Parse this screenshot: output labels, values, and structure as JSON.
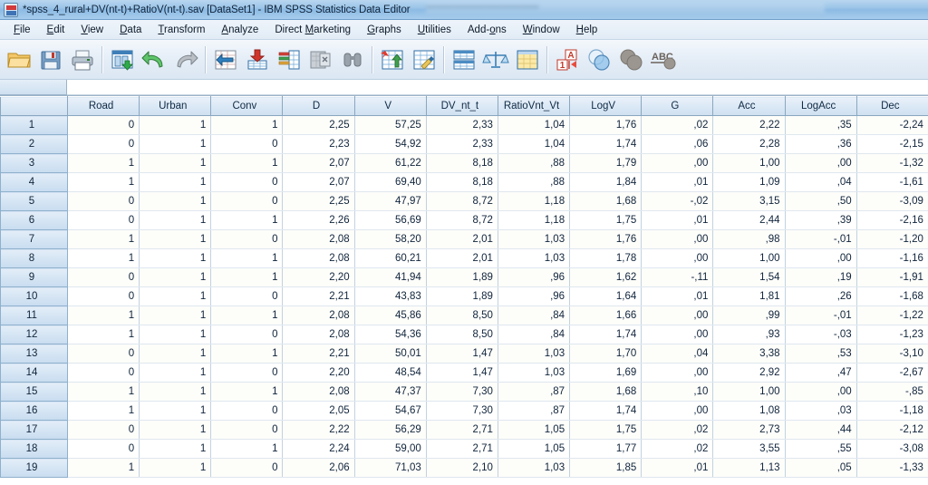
{
  "window": {
    "title": "*spss_4_rural+DV(nt-t)+RatioV(nt-t).sav [DataSet1] - IBM SPSS Statistics Data Editor",
    "icon": "spss-app-icon",
    "overlay_blurred_text": "••••••••••••••••••••••••••••••••"
  },
  "menubar": {
    "items": [
      {
        "label": "File",
        "accel": "F"
      },
      {
        "label": "Edit",
        "accel": "E"
      },
      {
        "label": "View",
        "accel": "V"
      },
      {
        "label": "Data",
        "accel": "D"
      },
      {
        "label": "Transform",
        "accel": "T"
      },
      {
        "label": "Analyze",
        "accel": "A"
      },
      {
        "label": "Direct Marketing",
        "accel": "M"
      },
      {
        "label": "Graphs",
        "accel": "G"
      },
      {
        "label": "Utilities",
        "accel": "U"
      },
      {
        "label": "Add-ons",
        "accel": "o"
      },
      {
        "label": "Window",
        "accel": "W"
      },
      {
        "label": "Help",
        "accel": "H"
      }
    ]
  },
  "toolbar": {
    "buttons": [
      {
        "name": "open-file-icon",
        "tooltip": "Open data document"
      },
      {
        "name": "save-icon",
        "tooltip": "Save this document"
      },
      {
        "name": "print-icon",
        "tooltip": "Print"
      },
      {
        "name": "recall-dialogs-icon",
        "tooltip": "Recall recently used dialogs"
      },
      {
        "name": "undo-icon",
        "tooltip": "Undo a user action"
      },
      {
        "name": "redo-icon",
        "tooltip": "Redo a user action"
      },
      {
        "name": "goto-case-icon",
        "tooltip": "Go to case"
      },
      {
        "name": "goto-variable-icon",
        "tooltip": "Go to variable"
      },
      {
        "name": "variables-icon",
        "tooltip": "Variables"
      },
      {
        "name": "find-icon",
        "tooltip": "Find"
      },
      {
        "name": "insert-case-icon",
        "tooltip": "Insert cases"
      },
      {
        "name": "insert-variable-icon",
        "tooltip": "Insert variable"
      },
      {
        "name": "split-file-icon",
        "tooltip": "Split file"
      },
      {
        "name": "weight-cases-icon",
        "tooltip": "Weight cases"
      },
      {
        "name": "select-cases-icon",
        "tooltip": "Select cases"
      },
      {
        "name": "value-labels-icon",
        "tooltip": "Value labels"
      },
      {
        "name": "use-variable-sets-icon",
        "tooltip": "Use variable sets"
      },
      {
        "name": "show-all-variables-icon",
        "tooltip": "Show all variables"
      },
      {
        "name": "spell-check-icon",
        "tooltip": "Spell check"
      }
    ]
  },
  "cell_reference": {
    "name": "",
    "value": ""
  },
  "grid": {
    "corner_label": "",
    "columns": [
      "Road",
      "Urban",
      "Conv",
      "D",
      "V",
      "DV_nt_t",
      "RatioVnt_Vt",
      "LogV",
      "G",
      "Acc",
      "LogAcc",
      "Dec"
    ],
    "rows": [
      {
        "num": "1",
        "cells": [
          "0",
          "1",
          "1",
          "2,25",
          "57,25",
          "2,33",
          "1,04",
          "1,76",
          ",02",
          "2,22",
          ",35",
          "-2,24"
        ]
      },
      {
        "num": "2",
        "cells": [
          "0",
          "1",
          "0",
          "2,23",
          "54,92",
          "2,33",
          "1,04",
          "1,74",
          ",06",
          "2,28",
          ",36",
          "-2,15"
        ]
      },
      {
        "num": "3",
        "cells": [
          "1",
          "1",
          "1",
          "2,07",
          "61,22",
          "8,18",
          ",88",
          "1,79",
          ",00",
          "1,00",
          ",00",
          "-1,32"
        ]
      },
      {
        "num": "4",
        "cells": [
          "1",
          "1",
          "0",
          "2,07",
          "69,40",
          "8,18",
          ",88",
          "1,84",
          ",01",
          "1,09",
          ",04",
          "-1,61"
        ]
      },
      {
        "num": "5",
        "cells": [
          "0",
          "1",
          "0",
          "2,25",
          "47,97",
          "8,72",
          "1,18",
          "1,68",
          "-,02",
          "3,15",
          ",50",
          "-3,09"
        ]
      },
      {
        "num": "6",
        "cells": [
          "0",
          "1",
          "1",
          "2,26",
          "56,69",
          "8,72",
          "1,18",
          "1,75",
          ",01",
          "2,44",
          ",39",
          "-2,16"
        ]
      },
      {
        "num": "7",
        "cells": [
          "1",
          "1",
          "0",
          "2,08",
          "58,20",
          "2,01",
          "1,03",
          "1,76",
          ",00",
          ",98",
          "-,01",
          "-1,20"
        ]
      },
      {
        "num": "8",
        "cells": [
          "1",
          "1",
          "1",
          "2,08",
          "60,21",
          "2,01",
          "1,03",
          "1,78",
          ",00",
          "1,00",
          ",00",
          "-1,16"
        ]
      },
      {
        "num": "9",
        "cells": [
          "0",
          "1",
          "1",
          "2,20",
          "41,94",
          "1,89",
          ",96",
          "1,62",
          "-,11",
          "1,54",
          ",19",
          "-1,91"
        ]
      },
      {
        "num": "10",
        "cells": [
          "0",
          "1",
          "0",
          "2,21",
          "43,83",
          "1,89",
          ",96",
          "1,64",
          ",01",
          "1,81",
          ",26",
          "-1,68"
        ]
      },
      {
        "num": "11",
        "cells": [
          "1",
          "1",
          "1",
          "2,08",
          "45,86",
          "8,50",
          ",84",
          "1,66",
          ",00",
          ",99",
          "-,01",
          "-1,22"
        ]
      },
      {
        "num": "12",
        "cells": [
          "1",
          "1",
          "0",
          "2,08",
          "54,36",
          "8,50",
          ",84",
          "1,74",
          ",00",
          ",93",
          "-,03",
          "-1,23"
        ]
      },
      {
        "num": "13",
        "cells": [
          "0",
          "1",
          "1",
          "2,21",
          "50,01",
          "1,47",
          "1,03",
          "1,70",
          ",04",
          "3,38",
          ",53",
          "-3,10"
        ]
      },
      {
        "num": "14",
        "cells": [
          "0",
          "1",
          "0",
          "2,20",
          "48,54",
          "1,47",
          "1,03",
          "1,69",
          ",00",
          "2,92",
          ",47",
          "-2,67"
        ]
      },
      {
        "num": "15",
        "cells": [
          "1",
          "1",
          "1",
          "2,08",
          "47,37",
          "7,30",
          ",87",
          "1,68",
          ",10",
          "1,00",
          ",00",
          "-,85"
        ]
      },
      {
        "num": "16",
        "cells": [
          "1",
          "1",
          "0",
          "2,05",
          "54,67",
          "7,30",
          ",87",
          "1,74",
          ",00",
          "1,08",
          ",03",
          "-1,18"
        ]
      },
      {
        "num": "17",
        "cells": [
          "0",
          "1",
          "0",
          "2,22",
          "56,29",
          "2,71",
          "1,05",
          "1,75",
          ",02",
          "2,73",
          ",44",
          "-2,12"
        ]
      },
      {
        "num": "18",
        "cells": [
          "0",
          "1",
          "1",
          "2,24",
          "59,00",
          "2,71",
          "1,05",
          "1,77",
          ",02",
          "3,55",
          ",55",
          "-3,08"
        ]
      },
      {
        "num": "19",
        "cells": [
          "1",
          "1",
          "0",
          "2,06",
          "71,03",
          "2,10",
          "1,03",
          "1,85",
          ",01",
          "1,13",
          ",05",
          "-1,33"
        ]
      }
    ]
  },
  "colors": {
    "title_bar": "#9ec6e8",
    "header_blue": "#cfe0f0",
    "row_header_blue": "#d4e4f3",
    "grid_line": "#c3d2e0",
    "text": "#10243b"
  }
}
